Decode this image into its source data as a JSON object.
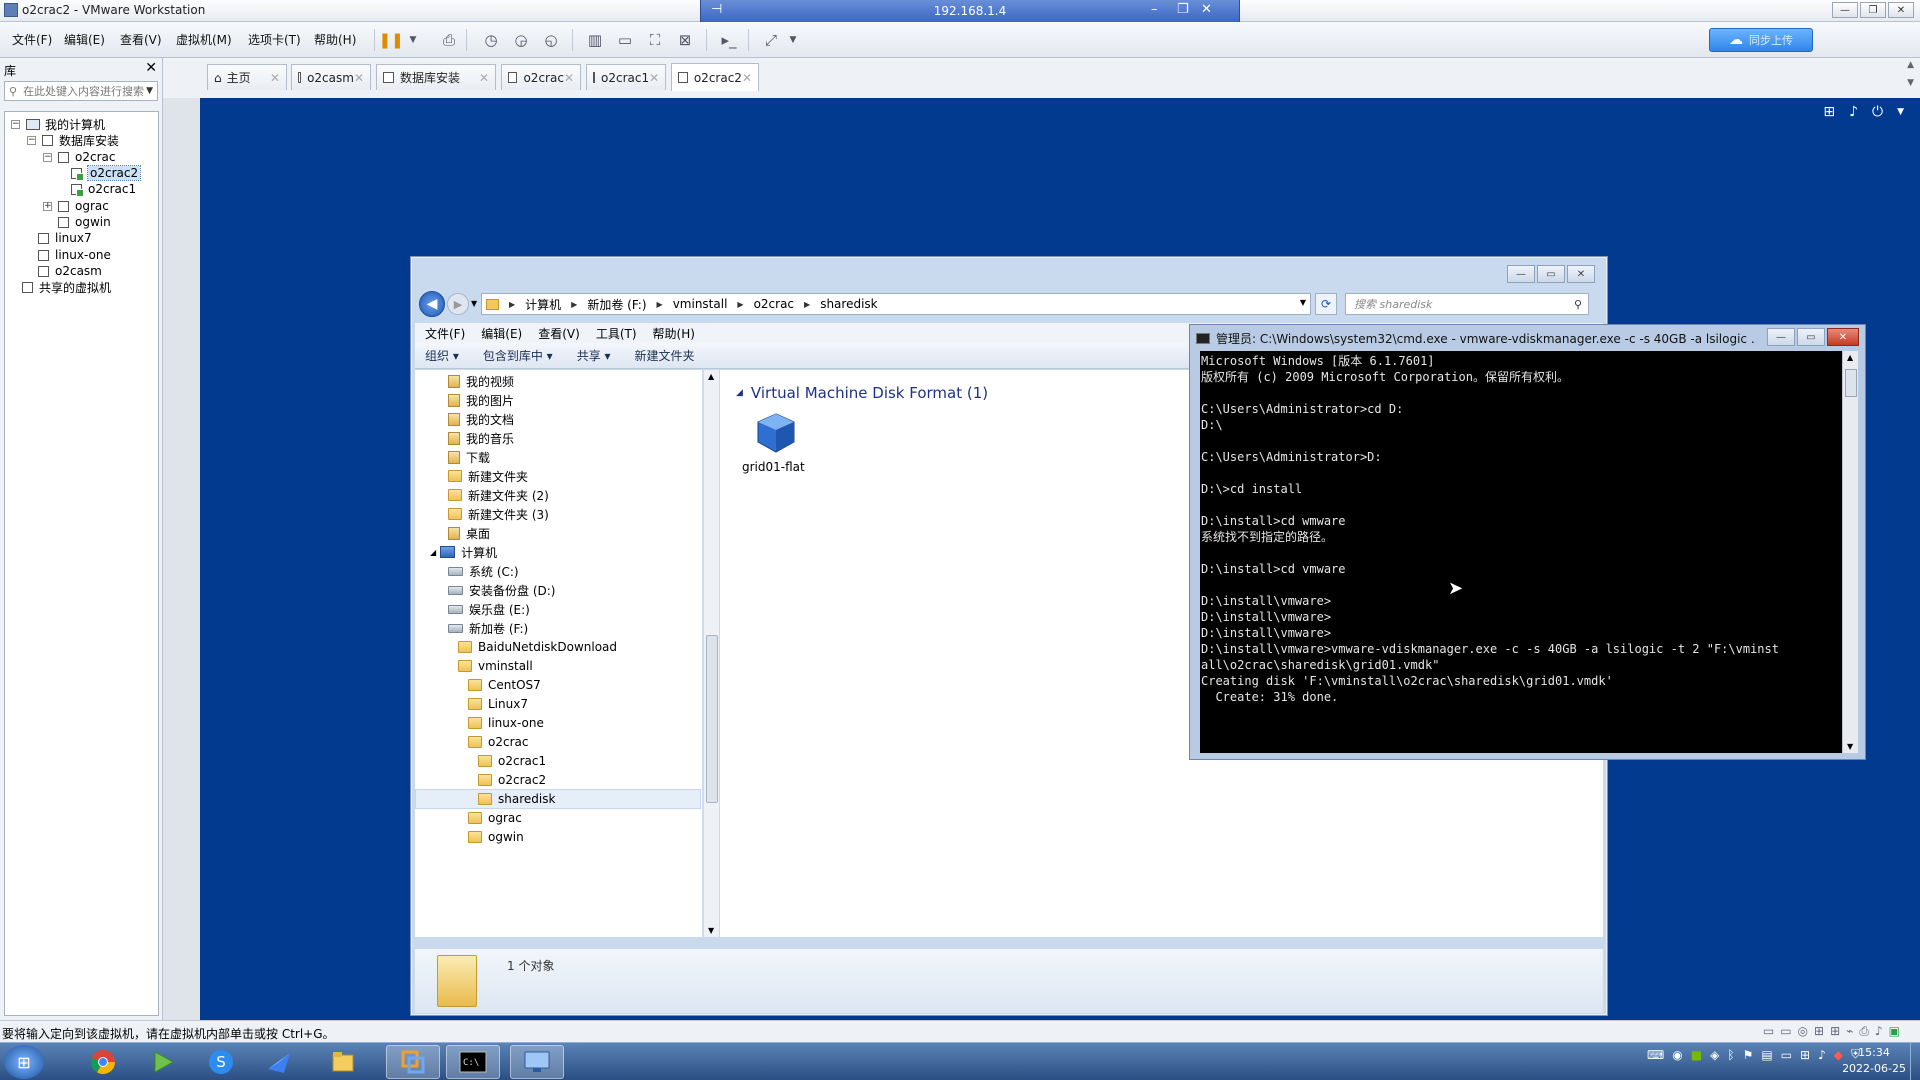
{
  "window": {
    "title": "o2crac2 - VMware Workstation",
    "remote_ip": "192.168.1.4"
  },
  "menubar": {
    "items": [
      "文件(F)",
      "编辑(E)",
      "查看(V)",
      "虚拟机(M)",
      "选项卡(T)",
      "帮助(H)"
    ]
  },
  "toolbar": {
    "icons": [
      "pause-icon",
      "send-keys-icon",
      "snapshot-icon",
      "revert-snapshot-icon",
      "snapshot-manager-icon",
      "library-view-icon",
      "thumbnail-view-icon",
      "fullscreen-icon",
      "unity-icon",
      "console-icon",
      "stretch-icon"
    ],
    "sync_label": "同步上传"
  },
  "library": {
    "title": "库",
    "search_placeholder": "在此处键入内容进行搜索",
    "tree": [
      "我的计算机",
      "数据库安装",
      "o2crac",
      "o2crac2",
      "o2crac1",
      "ograc",
      "ogwin",
      "linux7",
      "linux-one",
      "o2casm",
      "共享的虚拟机"
    ]
  },
  "tabs": [
    "主页",
    "o2casm",
    "数据库安装",
    "o2crac",
    "o2crac1",
    "o2crac2"
  ],
  "active_tab": "o2crac2",
  "explorer": {
    "breadcrumb": [
      "计算机",
      "新加卷 (F:)",
      "vminstall",
      "o2crac",
      "sharedisk"
    ],
    "search_placeholder": "搜索 sharedisk",
    "menu": [
      "文件(F)",
      "编辑(E)",
      "查看(V)",
      "工具(T)",
      "帮助(H)"
    ],
    "commands": [
      "组织 ▾",
      "包含到库中 ▾",
      "共享 ▾",
      "新建文件夹"
    ],
    "nav": [
      "我的视频",
      "我的图片",
      "我的文档",
      "我的音乐",
      "下载",
      "新建文件夹",
      "新建文件夹 (2)",
      "新建文件夹 (3)",
      "桌面",
      "计算机",
      "系统 (C:)",
      "安装备份盘 (D:)",
      "娱乐盘 (E:)",
      "新加卷 (F:)",
      "BaiduNetdiskDownload",
      "vminstall",
      "CentOS7",
      "Linux7",
      "linux-one",
      "o2crac",
      "o2crac1",
      "o2crac2",
      "sharedisk",
      "ograc",
      "ogwin"
    ],
    "group_header": "Virtual Machine Disk Format (1)",
    "file_name": "grid01-flat",
    "status": "1 个对象"
  },
  "cmd": {
    "title": "管理员: C:\\Windows\\system32\\cmd.exe - vmware-vdiskmanager.exe  -c -s 40GB -a lsilogic ...",
    "lines": [
      "Microsoft Windows [版本 6.1.7601]",
      "版权所有 (c) 2009 Microsoft Corporation。保留所有权利。",
      "",
      "C:\\Users\\Administrator>cd D:",
      "D:\\",
      "",
      "C:\\Users\\Administrator>D:",
      "",
      "D:\\>cd install",
      "",
      "D:\\install>cd wmware",
      "系统找不到指定的路径。",
      "",
      "D:\\install>cd vmware",
      "",
      "D:\\install\\vmware>",
      "D:\\install\\vmware>",
      "D:\\install\\vmware>",
      "D:\\install\\vmware>vmware-vdiskmanager.exe -c -s 40GB -a lsilogic -t 2 \"F:\\vminst",
      "all\\o2crac\\sharedisk\\grid01.vmdk\"",
      "Creating disk 'F:\\vminstall\\o2crac\\sharedisk\\grid01.vmdk'",
      "  Create: 31% done."
    ]
  },
  "statusbar": {
    "message": "要将输入定向到该虚拟机，请在虚拟机内部单击或按 Ctrl+G。"
  },
  "taskbar": {
    "time": "15:34",
    "date": "2022-06-25"
  }
}
